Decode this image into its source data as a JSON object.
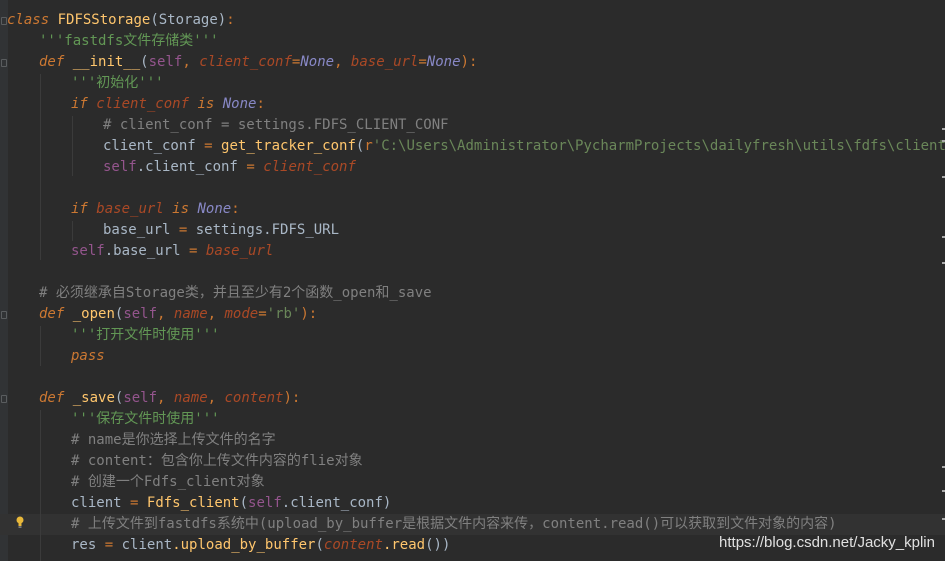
{
  "code": {
    "lines": [
      {
        "kw": "class",
        "name": "FDFSStorage",
        "base": "Storage",
        "end": ":"
      },
      {
        "doc": "'''fastdfs文件存储类'''"
      },
      {
        "kw": "def",
        "fname": "__init__",
        "p1": "self",
        "a1": "client_conf",
        "d1": "None",
        "a2": "base_url",
        "d2": "None",
        "end": "):"
      },
      {
        "doc": "'''初始化'''"
      },
      {
        "kw": "if",
        "v": "client_conf",
        "is": "is",
        "none": "None",
        "end": ":"
      },
      {
        "comment": "# client_conf = settings.FDFS_CLIENT_CONF"
      },
      {
        "lhs": "client_conf",
        "eq": "=",
        "call": "get_tracker_conf",
        "rawprefix": "r",
        "str": "'C:\\Users\\Administrator\\PycharmProjects\\dailyfresh\\utils\\fdfs\\client.conf'"
      },
      {
        "self": "self",
        "attr": ".client_conf",
        "eq": "=",
        "rhs": "client_conf"
      },
      {},
      {
        "kw": "if",
        "v": "base_url",
        "is": "is",
        "none": "None",
        "end": ":"
      },
      {
        "lhs": "base_url",
        "eq": "=",
        "rhs": "settings.FDFS_URL"
      },
      {
        "self": "self",
        "attr": ".base_url",
        "eq": "=",
        "rhs": "base_url"
      },
      {},
      {
        "comment": "# 必须继承自Storage类，并且至少有2个函数_open和_save"
      },
      {
        "kw": "def",
        "fname": "_open",
        "p1": "self",
        "a1": "name",
        "a2": "mode",
        "d2": "'rb'",
        "end": "):"
      },
      {
        "doc": "'''打开文件时使用'''"
      },
      {
        "kw": "pass"
      },
      {},
      {
        "kw": "def",
        "fname": "_save",
        "p1": "self",
        "a1": "name",
        "a2": "content",
        "end": "):"
      },
      {
        "doc": "'''保存文件时使用'''"
      },
      {
        "comment": "# name是你选择上传文件的名字"
      },
      {
        "comment": "# content：包含你上传文件内容的flie对象"
      },
      {
        "comment": "# 创建一个Fdfs_client对象"
      },
      {
        "lhs": "client",
        "eq": "=",
        "call": "Fdfs_client",
        "self": "self",
        "attr": ".client_conf"
      },
      {
        "comment": "# 上传文件到fastdfs系统中(upload_by_buffer是根据文件内容来传，content.read()可以获取到文件对象的内容)"
      },
      {
        "lhs": "res",
        "eq": "=",
        "obj": "client",
        "meth": ".upload_by_buffer",
        "arg": "content",
        "meth2": ".read"
      }
    ]
  },
  "watermark": "https://blog.csdn.net/Jacky_kplin",
  "colors": {
    "background": "#2b2b2b",
    "keyword": "#cc7832",
    "text": "#a9b7c6",
    "function": "#ffc66d",
    "string": "#6a8759",
    "comment": "#808080",
    "docstring": "#629755",
    "self": "#94558d",
    "param": "#aa4926",
    "builtin": "#8888c6"
  }
}
